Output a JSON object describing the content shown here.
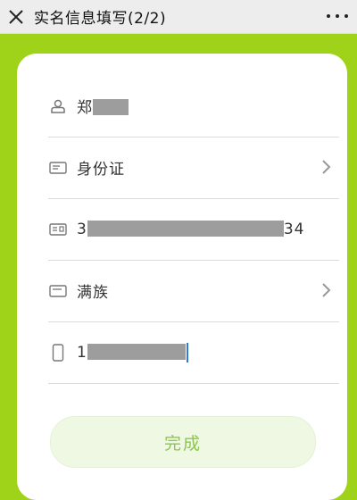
{
  "header": {
    "title": "实名信息填写(2/2)"
  },
  "form": {
    "name": {
      "value_prefix": "郑"
    },
    "id_type": {
      "value": "身份证"
    },
    "id_number": {
      "value_prefix": "3",
      "value_suffix": "34"
    },
    "ethnicity": {
      "value": "满族"
    },
    "phone": {
      "value_prefix": "1"
    }
  },
  "actions": {
    "submit_label": "完成"
  },
  "colors": {
    "page_background": "#9fd31a",
    "button_text": "#8fc650",
    "button_background": "#eef8e3",
    "caret": "#2c7de0"
  }
}
